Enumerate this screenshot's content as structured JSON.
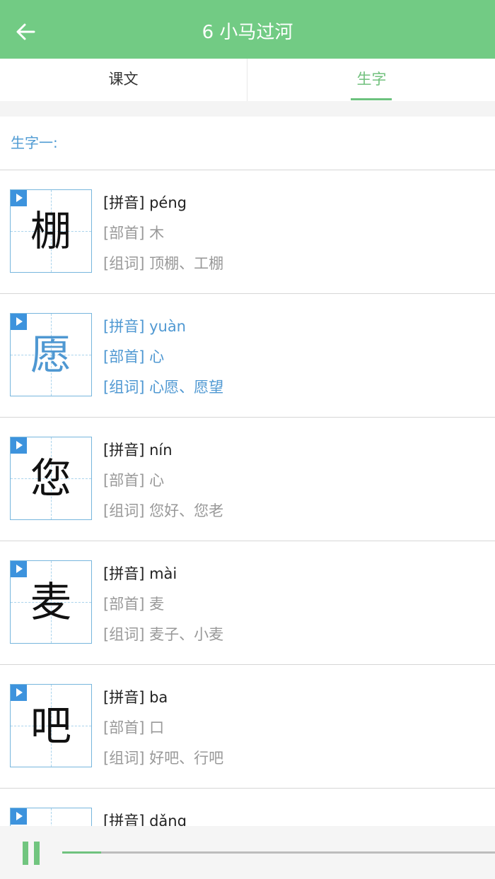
{
  "header": {
    "title": "6  小马过河",
    "back_icon": "arrow-left-icon"
  },
  "tabs": [
    {
      "label": "课文",
      "selected": false
    },
    {
      "label": "生字",
      "selected": true
    }
  ],
  "section": {
    "label": "生字一:"
  },
  "labels": {
    "pinyin": "[拼音]",
    "radical": "[部首]",
    "words": "[组词]"
  },
  "characters": [
    {
      "char": "棚",
      "pinyin": "péng",
      "radical": "木",
      "words": "顶棚、工棚",
      "active": false
    },
    {
      "char": "愿",
      "pinyin": "yuàn",
      "radical": "心",
      "words": "心愿、愿望",
      "active": true
    },
    {
      "char": "您",
      "pinyin": "nín",
      "radical": "心",
      "words": "您好、您老",
      "active": false
    },
    {
      "char": "麦",
      "pinyin": "mài",
      "radical": "麦",
      "words": "麦子、小麦",
      "active": false
    },
    {
      "char": "吧",
      "pinyin": "ba",
      "radical": "口",
      "words": "好吧、行吧",
      "active": false
    },
    {
      "char": "",
      "pinyin": "dǎng",
      "radical": "",
      "words": "",
      "active": false
    }
  ],
  "player": {
    "state": "playing",
    "progress": 0.09
  },
  "colors": {
    "accent_green": "#72cb84",
    "accent_blue": "#4f98d2",
    "play_button_blue": "#3d93dd"
  }
}
